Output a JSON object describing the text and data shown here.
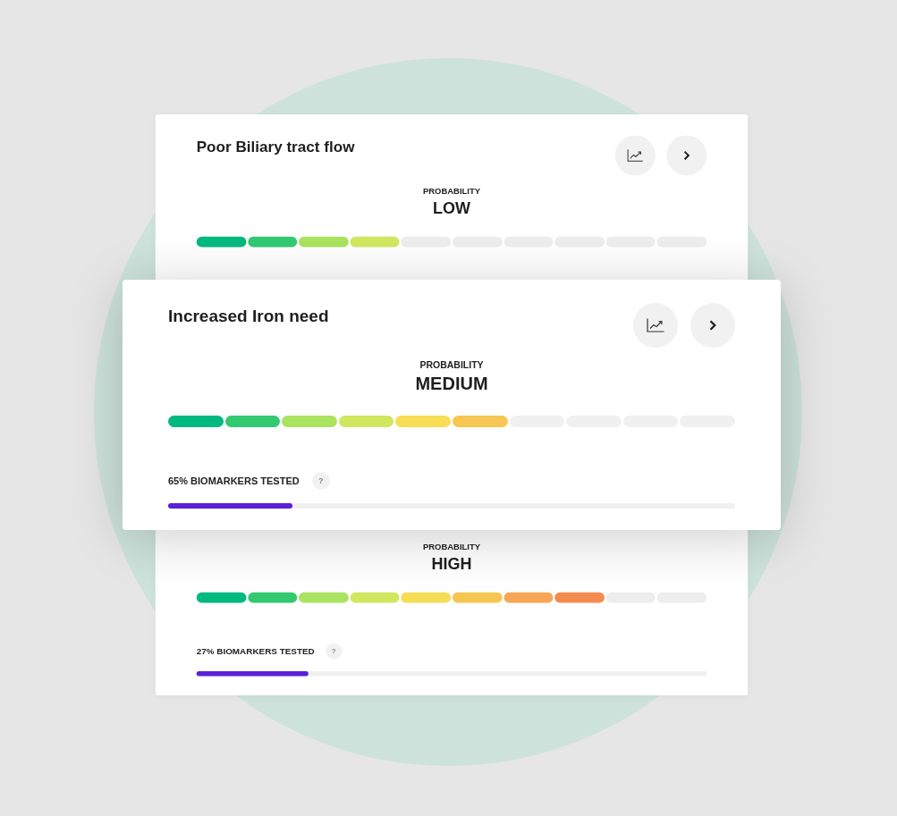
{
  "cards": [
    {
      "title": "Poor Biliary tract flow",
      "probability_label": "PROBABILITY",
      "probability": "LOW",
      "selected": false,
      "segments": [
        {
          "color": "#00b97e"
        },
        {
          "color": "#33c971"
        },
        {
          "color": "#a9e35f"
        },
        {
          "color": "#d0e75f"
        },
        {
          "color": "#ededed"
        },
        {
          "color": "#ededed"
        },
        {
          "color": "#ededed"
        },
        {
          "color": "#ededed"
        },
        {
          "color": "#ededed"
        },
        {
          "color": "#ededed"
        }
      ]
    },
    {
      "title": "Increased Iron need",
      "probability_label": "PROBABILITY",
      "probability": "MEDIUM",
      "selected": true,
      "segments": [
        {
          "color": "#00b97e"
        },
        {
          "color": "#33c971"
        },
        {
          "color": "#a9e35f"
        },
        {
          "color": "#d0e75f"
        },
        {
          "color": "#f8dd55"
        },
        {
          "color": "#f8c653"
        },
        {
          "color": "#f0f0f0"
        },
        {
          "color": "#f0f0f0"
        },
        {
          "color": "#f0f0f0"
        },
        {
          "color": "#f0f0f0"
        }
      ],
      "biomarkers": {
        "label": "65% BIOMARKERS TESTED",
        "help": "?",
        "level": 0.22
      }
    },
    {
      "probability_label": "PROBABILITY",
      "probability": "HIGH",
      "selected": false,
      "segments": [
        {
          "color": "#00b97e"
        },
        {
          "color": "#33c971"
        },
        {
          "color": "#a9e35f"
        },
        {
          "color": "#d0e75f"
        },
        {
          "color": "#f5dc55"
        },
        {
          "color": "#f6c653"
        },
        {
          "color": "#f7a656"
        },
        {
          "color": "#f58c4f"
        },
        {
          "color": "#ededed"
        },
        {
          "color": "#ededed"
        }
      ],
      "biomarkers": {
        "label": "27% BIOMARKERS TESTED",
        "help": "?",
        "level": 0.22
      }
    }
  ]
}
